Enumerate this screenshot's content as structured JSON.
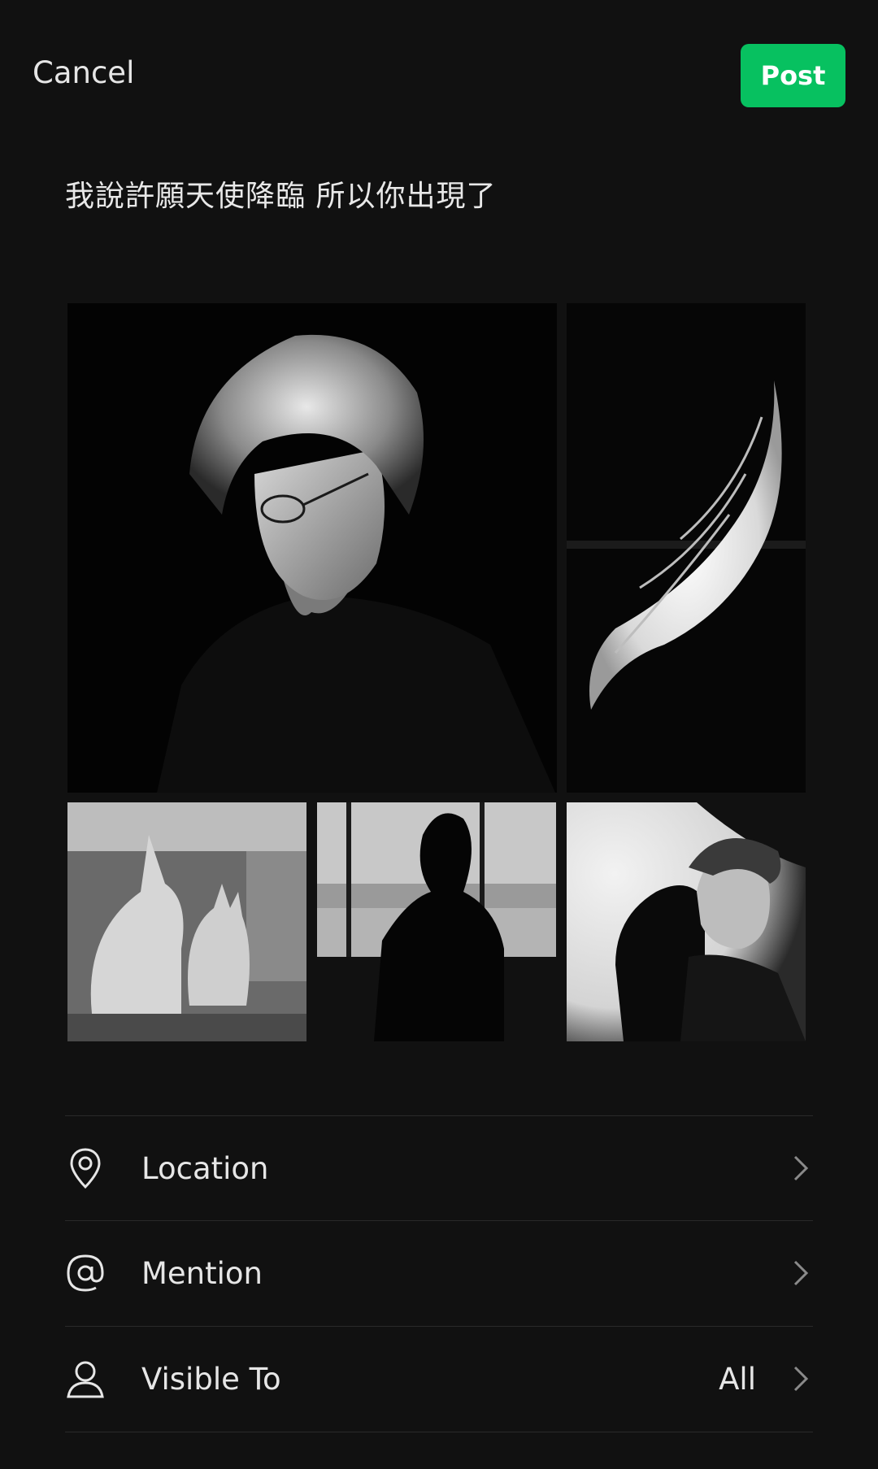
{
  "header": {
    "cancel_label": "Cancel",
    "post_label": "Post",
    "accent_color": "#07c160"
  },
  "post": {
    "caption": "我說許願天使降臨 所以你出現了"
  },
  "photos": [
    {
      "name": "photo-man-glasses",
      "icon": "portrait-image"
    },
    {
      "name": "photo-angel-wing",
      "icon": "wing-image"
    },
    {
      "name": "photo-cats",
      "icon": "cats-image"
    },
    {
      "name": "photo-silhouette-window",
      "icon": "silhouette-image"
    },
    {
      "name": "photo-man-panther",
      "icon": "panther-image"
    }
  ],
  "options": [
    {
      "label": "Location",
      "icon": "location-pin-icon",
      "value": ""
    },
    {
      "label": "Mention",
      "icon": "at-sign-icon",
      "value": ""
    },
    {
      "label": "Visible To",
      "icon": "person-icon",
      "value": "All"
    }
  ]
}
